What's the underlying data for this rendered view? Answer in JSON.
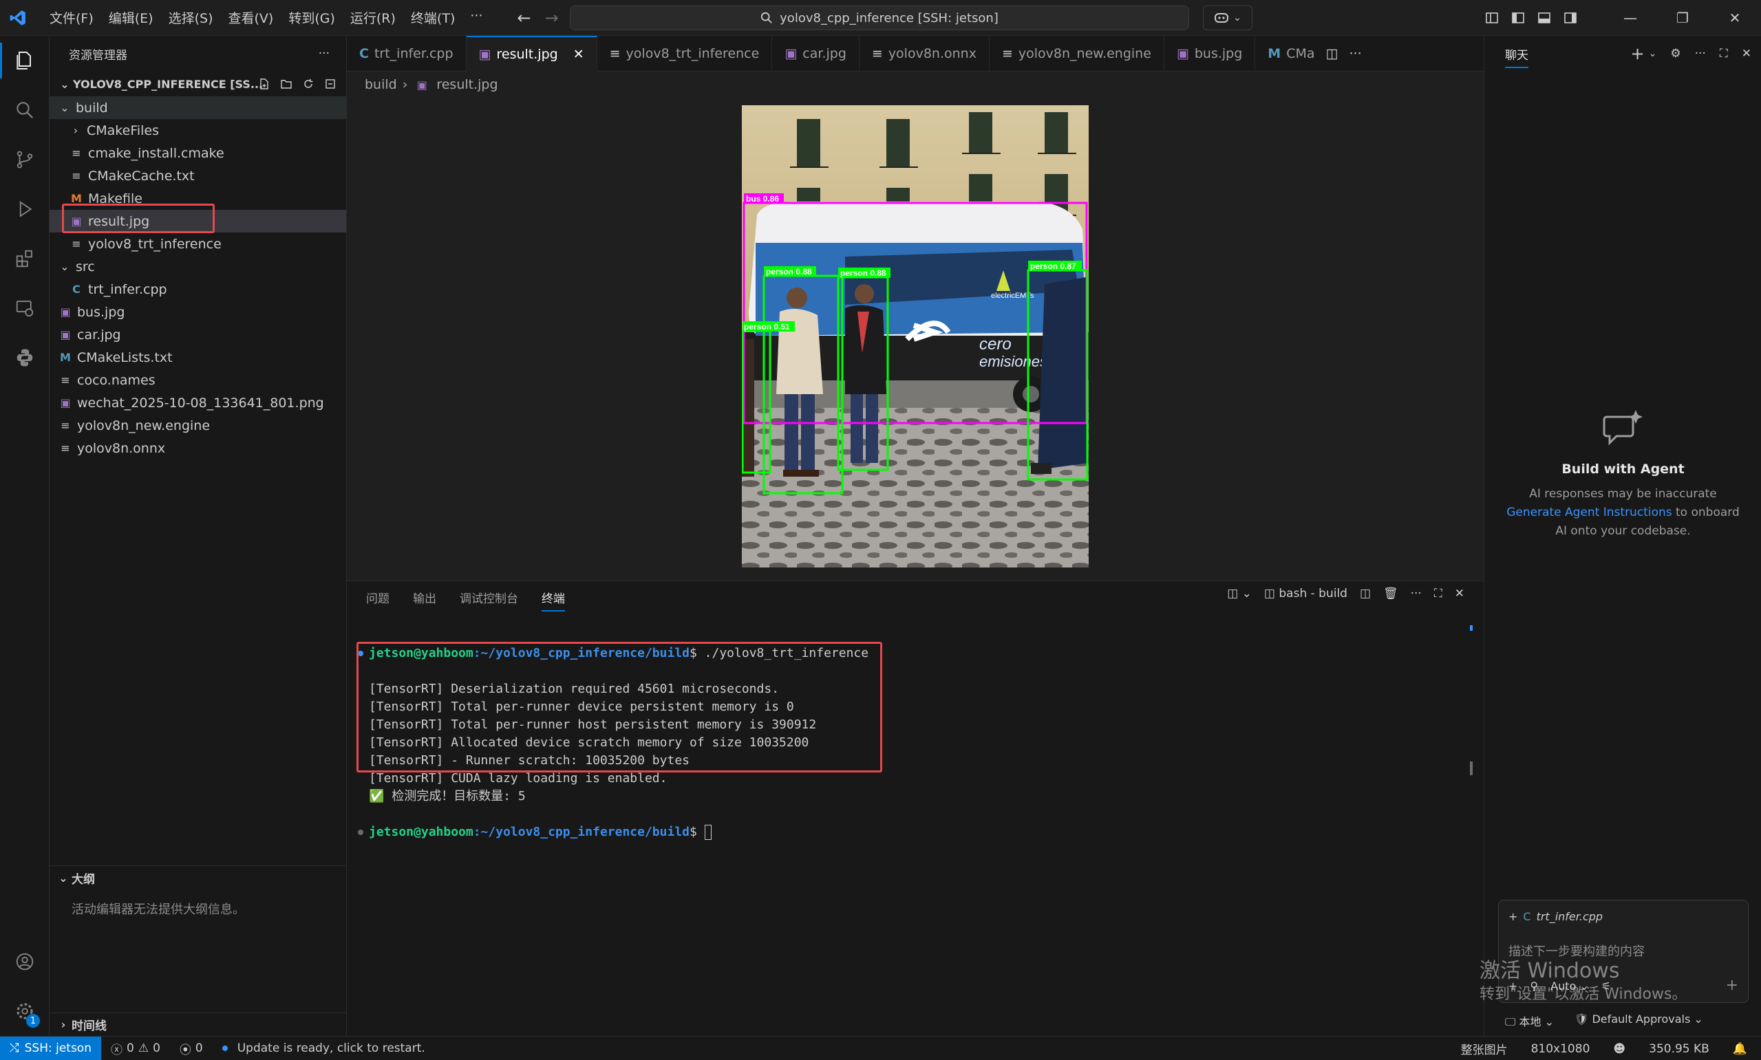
{
  "window": {
    "search_text": "yolov8_cpp_inference [SSH: jetson]",
    "menu": [
      "文件(F)",
      "编辑(E)",
      "选择(S)",
      "查看(V)",
      "转到(G)",
      "运行(R)",
      "终端(T)",
      "···"
    ]
  },
  "sidebar": {
    "title": "资源管理器",
    "project": "YOLOV8_CPP_INFERENCE [SS...",
    "tree": [
      {
        "label": "build",
        "type": "folder-open",
        "depth": 0
      },
      {
        "label": "CMakeFiles",
        "type": "folder",
        "depth": 1
      },
      {
        "label": "cmake_install.cmake",
        "type": "lines",
        "depth": 1
      },
      {
        "label": "CMakeCache.txt",
        "type": "lines",
        "depth": 1
      },
      {
        "label": "Makefile",
        "type": "makefile",
        "depth": 1
      },
      {
        "label": "result.jpg",
        "type": "image",
        "depth": 1
      },
      {
        "label": "yolov8_trt_inference",
        "type": "lines",
        "depth": 1
      },
      {
        "label": "src",
        "type": "folder-open",
        "depth": 0
      },
      {
        "label": "trt_infer.cpp",
        "type": "cpp",
        "depth": 1
      },
      {
        "label": "bus.jpg",
        "type": "image",
        "depth": 0
      },
      {
        "label": "car.jpg",
        "type": "image",
        "depth": 0
      },
      {
        "label": "CMakeLists.txt",
        "type": "cmake",
        "depth": 0
      },
      {
        "label": "coco.names",
        "type": "lines",
        "depth": 0
      },
      {
        "label": "wechat_2025-10-08_133641_801.png",
        "type": "image",
        "depth": 0
      },
      {
        "label": "yolov8n_new.engine",
        "type": "lines",
        "depth": 0
      },
      {
        "label": "yolov8n.onnx",
        "type": "lines",
        "depth": 0
      }
    ],
    "outline_title": "大纲",
    "outline_msg": "活动编辑器无法提供大纲信息。",
    "timeline_title": "时间线"
  },
  "editor": {
    "tabs": [
      {
        "label": "trt_infer.cpp",
        "icon": "cpp"
      },
      {
        "label": "result.jpg",
        "icon": "image",
        "active": true
      },
      {
        "label": "yolov8_trt_inference",
        "icon": "lines"
      },
      {
        "label": "car.jpg",
        "icon": "image"
      },
      {
        "label": "yolov8n.onnx",
        "icon": "lines"
      },
      {
        "label": "yolov8n_new.engine",
        "icon": "lines"
      },
      {
        "label": "bus.jpg",
        "icon": "image"
      },
      {
        "label": "CMa",
        "icon": "cmake"
      }
    ],
    "breadcrumb": [
      "build",
      "result.jpg"
    ],
    "detections": [
      {
        "label": "bus 0.86"
      },
      {
        "label": "person 0.88"
      },
      {
        "label": "person 0.88"
      },
      {
        "label": "person 0.87"
      },
      {
        "label": "person 0.51"
      }
    ],
    "bus_text": [
      "cero",
      "emisiones"
    ],
    "bus_sign": "electricEMTs"
  },
  "panel": {
    "tabs": [
      "问题",
      "输出",
      "调试控制台",
      "终端"
    ],
    "active_tab": "终端",
    "terminal_name": "bash - build",
    "prompt_user": "jetson@yahboom",
    "prompt_path": ":~/yolov8_cpp_inference/build",
    "command": "$ ./yolov8_trt_inference",
    "output": [
      "[TensorRT] Deserialization required 45601 microseconds.",
      "[TensorRT] Total per-runner device persistent memory is 0",
      "[TensorRT] Total per-runner host persistent memory is 390912",
      "[TensorRT] Allocated device scratch memory of size 10035200",
      "[TensorRT] - Runner scratch: 10035200 bytes",
      "[TensorRT] CUDA lazy loading is enabled.",
      "✅ 检测完成！目标数量: 5"
    ],
    "prompt_end": "$ "
  },
  "chat": {
    "title": "聊天",
    "agent_title": "Build with Agent",
    "agent_line1": "AI responses may be inaccurate",
    "agent_link": "Generate Agent Instructions",
    "agent_line2_suffix": " to onboard",
    "agent_line3": "AI onto your codebase.",
    "context_file": "trt_infer.cpp",
    "placeholder": "描述下一步要构建的内容",
    "mode": "Auto",
    "footer_local": "本地",
    "footer_approvals": "Default Approvals"
  },
  "watermark": {
    "line1": "激活 Windows",
    "line2": "转到\"设置\"以激活 Windows。"
  },
  "status": {
    "remote": "SSH: jetson",
    "errors": "0",
    "warnings": "0",
    "ports": "0",
    "update": "Update is ready, click to restart.",
    "image_mode": "整张图片",
    "resolution": "810x1080",
    "size": "350.95 KB"
  },
  "colors": {
    "accent": "#0078d4",
    "highlight": "#e5484d",
    "bus_box": "#ff00ff",
    "person_box": "#00ff00"
  }
}
